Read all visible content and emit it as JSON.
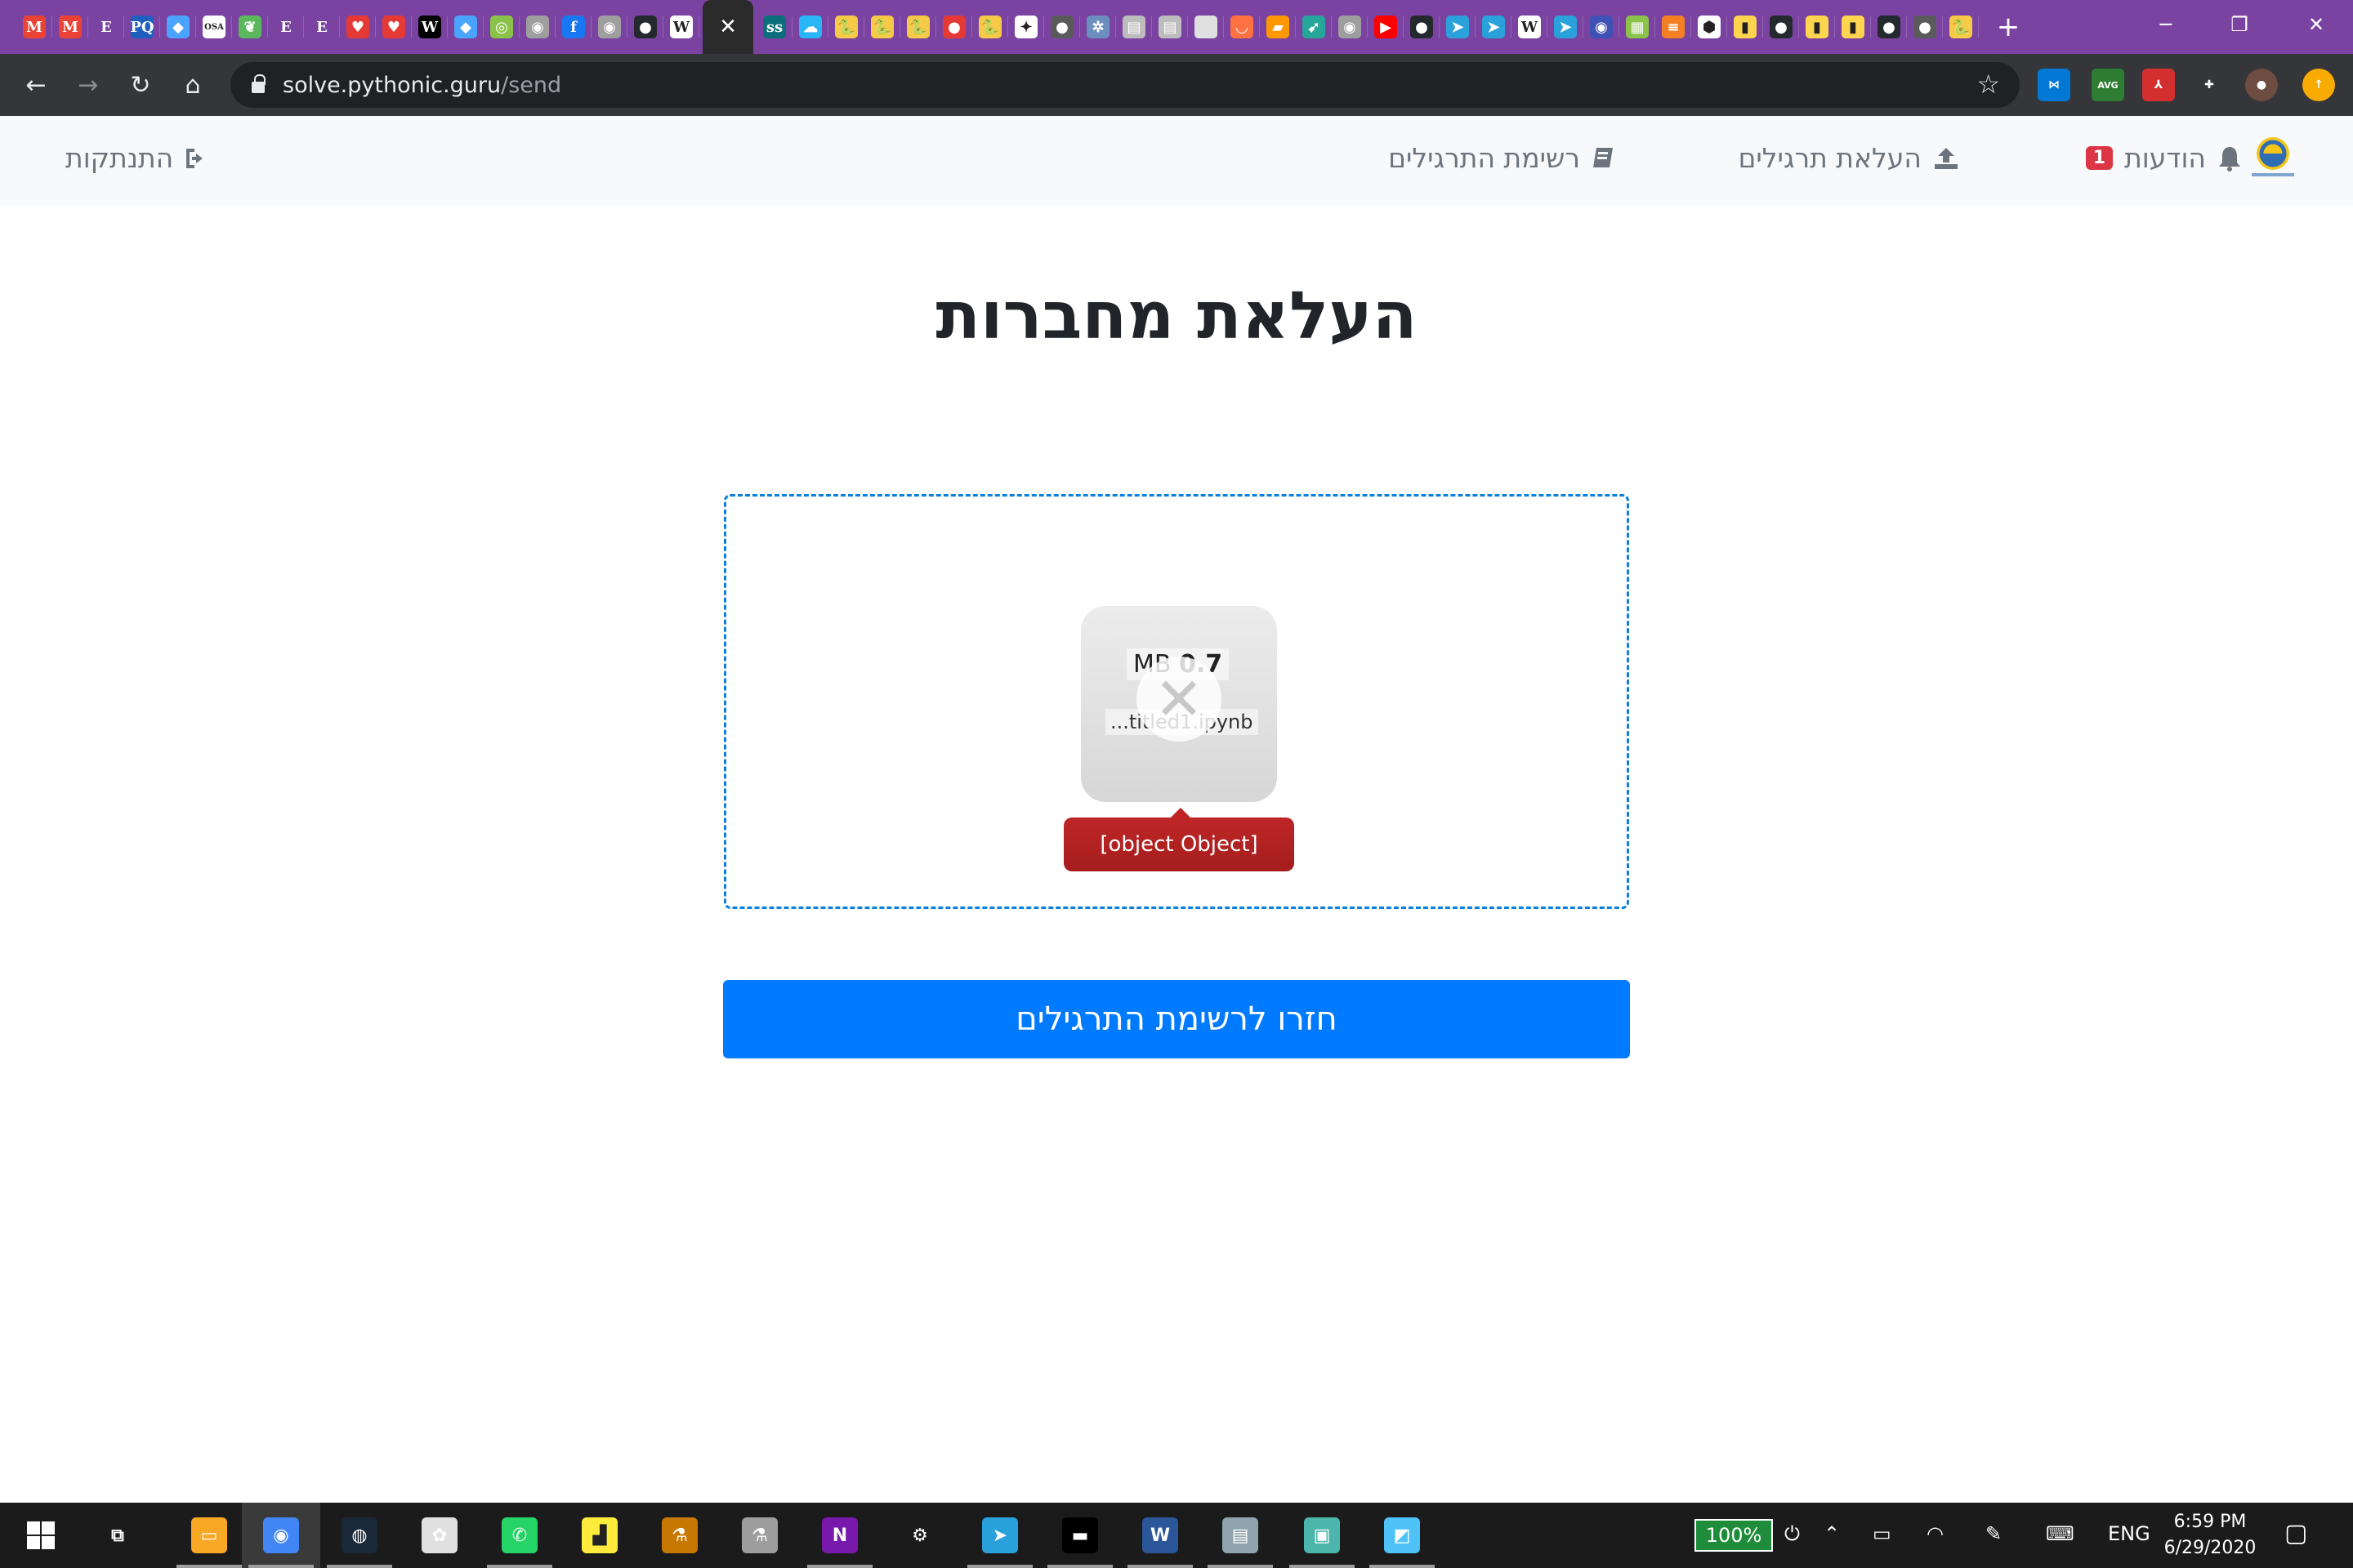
{
  "browser": {
    "tab_favicons": [
      {
        "icon": "gmail-icon",
        "color": "#ea4335",
        "glyph": "M"
      },
      {
        "icon": "gmail-icon",
        "color": "#ea4335",
        "glyph": "M"
      },
      {
        "icon": "e-icon",
        "color": "#7b43a1",
        "glyph": "E"
      },
      {
        "icon": "pq-icon",
        "color": "#1f5fbf",
        "glyph": "PQ"
      },
      {
        "icon": "shield-icon",
        "color": "#4aa3ff",
        "glyph": "◆"
      },
      {
        "icon": "osa-icon",
        "color": "#ffffff",
        "glyph": "OSA"
      },
      {
        "icon": "leaf-icon",
        "color": "#5cb85c",
        "glyph": "❦"
      },
      {
        "icon": "e-icon",
        "color": "#7b43a1",
        "glyph": "E"
      },
      {
        "icon": "e-icon",
        "color": "#7b43a1",
        "glyph": "E"
      },
      {
        "icon": "heart-icon",
        "color": "#e53935",
        "glyph": "♥"
      },
      {
        "icon": "heart-icon",
        "color": "#e53935",
        "glyph": "♥"
      },
      {
        "icon": "wikipedia-icon",
        "color": "#000000",
        "glyph": "W"
      },
      {
        "icon": "shield-icon",
        "color": "#4aa3ff",
        "glyph": "◆"
      },
      {
        "icon": "circle-icon",
        "color": "#8bc34a",
        "glyph": "◎"
      },
      {
        "icon": "globe-icon",
        "color": "#9e9e9e",
        "glyph": "◉"
      },
      {
        "icon": "facebook-icon",
        "color": "#1877f2",
        "glyph": "f"
      },
      {
        "icon": "globe-icon",
        "color": "#9e9e9e",
        "glyph": "◉"
      },
      {
        "icon": "github-icon",
        "color": "#24292e",
        "glyph": "●"
      },
      {
        "icon": "wikipedia-icon",
        "color": "#ffffff",
        "glyph": "W"
      }
    ],
    "tab_favicons_after": [
      {
        "icon": "ss-icon",
        "color": "#0b6e7a",
        "glyph": "ss"
      },
      {
        "icon": "cloud-icon",
        "color": "#29b6f6",
        "glyph": "☁"
      },
      {
        "icon": "python-icon",
        "color": "#f7c948",
        "glyph": "🐍"
      },
      {
        "icon": "python-icon",
        "color": "#f7c948",
        "glyph": "🐍"
      },
      {
        "icon": "python-icon",
        "color": "#f7c948",
        "glyph": "🐍"
      },
      {
        "icon": "red-dot-icon",
        "color": "#e53935",
        "glyph": "●"
      },
      {
        "icon": "python-icon",
        "color": "#f7c948",
        "glyph": "🐍"
      },
      {
        "icon": "butterfly-icon",
        "color": "#ffffff",
        "glyph": "✦"
      },
      {
        "icon": "dot-icon",
        "color": "#5a5a5a",
        "glyph": "●"
      },
      {
        "icon": "gear-icon",
        "color": "#6c8ebf",
        "glyph": "✲"
      },
      {
        "icon": "doc-icon",
        "color": "#bdbdbd",
        "glyph": "▤"
      },
      {
        "icon": "doc-icon",
        "color": "#bdbdbd",
        "glyph": "▤"
      },
      {
        "icon": "blank-icon",
        "color": "#e0e0e0",
        "glyph": ""
      },
      {
        "icon": "arc-icon",
        "color": "#ff7043",
        "glyph": "◡"
      },
      {
        "icon": "book-icon",
        "color": "#ff9800",
        "glyph": "▰"
      },
      {
        "icon": "arrow-icon",
        "color": "#26a69a",
        "glyph": "➹"
      },
      {
        "icon": "vinyl-icon",
        "color": "#9e9e9e",
        "glyph": "◉"
      },
      {
        "icon": "youtube-icon",
        "color": "#ff0000",
        "glyph": "▶"
      },
      {
        "icon": "github-icon",
        "color": "#24292e",
        "glyph": "●"
      },
      {
        "icon": "telegram-icon",
        "color": "#2aa1da",
        "glyph": "➤"
      },
      {
        "icon": "telegram-icon",
        "color": "#2aa1da",
        "glyph": "➤"
      },
      {
        "icon": "wikipedia-icon",
        "color": "#ffffff",
        "glyph": "W"
      },
      {
        "icon": "telegram-icon",
        "color": "#2aa1da",
        "glyph": "➤"
      },
      {
        "icon": "globe-icon",
        "color": "#3f51b5",
        "glyph": "◉"
      },
      {
        "icon": "grid-icon",
        "color": "#8bc34a",
        "glyph": "▦"
      },
      {
        "icon": "stack-icon",
        "color": "#f48024",
        "glyph": "≡"
      },
      {
        "icon": "cube-icon",
        "color": "#ffffff",
        "glyph": "⬢"
      },
      {
        "icon": "bookmark-icon",
        "color": "#ffd54f",
        "glyph": "▮"
      },
      {
        "icon": "github-icon",
        "color": "#24292e",
        "glyph": "●"
      },
      {
        "icon": "bookmark-icon",
        "color": "#ffd54f",
        "glyph": "▮"
      },
      {
        "icon": "bookmark-icon",
        "color": "#ffd54f",
        "glyph": "▮"
      },
      {
        "icon": "github-icon",
        "color": "#24292e",
        "glyph": "●"
      },
      {
        "icon": "dot-icon",
        "color": "#5a5a5a",
        "glyph": "●"
      },
      {
        "icon": "python-icon",
        "color": "#f7c948",
        "glyph": "🐍"
      }
    ],
    "active_tab_close": "✕",
    "new_tab": "+",
    "window_minimize": "─",
    "window_restore": "❐",
    "window_close": "✕",
    "back": "←",
    "forward": "→",
    "reload": "↻",
    "home": "⌂",
    "url_host": "solve.pythonic.guru",
    "url_path": "/send",
    "bookmark_star": "☆",
    "extensions": [
      {
        "icon": "vscode-icon",
        "color": "#0078d4",
        "glyph": "⋈"
      },
      {
        "icon": "avg-icon",
        "color": "#2e7d32",
        "glyph": "AVG"
      },
      {
        "icon": "pdf-icon",
        "color": "#d32f2f",
        "glyph": "⅄"
      },
      {
        "icon": "puzzle-icon",
        "color": "#35363a",
        "glyph": "✚"
      },
      {
        "icon": "avatar-icon",
        "color": "#6d4c41",
        "glyph": "●"
      },
      {
        "icon": "update-icon",
        "color": "#f9ab00",
        "glyph": "↑"
      }
    ]
  },
  "site": {
    "logo_alt": "לומדים פייתון",
    "nav": {
      "notifications_label": "הודעות",
      "notifications_count": "1",
      "upload_label": "העלאת תרגילים",
      "exercises_label": "רשימת התרגילים",
      "logout_label": "התנתקות"
    },
    "page_title": "העלאת מחברות",
    "dropzone": {
      "file_size_unit": "MB",
      "file_size_value": "0.7",
      "file_name": "...titled1.ipynb",
      "error_message": "[object Object]"
    },
    "back_button": "חזרו לרשימת התרגילים"
  },
  "taskbar": {
    "battery": "100%",
    "language": "ENG",
    "time": "6:59 PM",
    "date": "6/29/2020",
    "apps": [
      {
        "icon": "task-view-icon",
        "color": "#1b1b1b",
        "glyph": "⧉"
      },
      {
        "icon": "file-explorer-icon",
        "color": "#f9a825",
        "glyph": "▭"
      },
      {
        "icon": "chrome-icon",
        "color": "#4285f4",
        "glyph": "◉"
      },
      {
        "icon": "steam-icon",
        "color": "#1b2838",
        "glyph": "◍"
      },
      {
        "icon": "paint-icon",
        "color": "#e0e0e0",
        "glyph": "✿"
      },
      {
        "icon": "whatsapp-icon",
        "color": "#25d366",
        "glyph": "✆"
      },
      {
        "icon": "sticky-notes-icon",
        "color": "#ffeb3b",
        "glyph": "▟"
      },
      {
        "icon": "microscope-icon",
        "color": "#c77800",
        "glyph": "⚗"
      },
      {
        "icon": "microscope-icon",
        "color": "#9e9e9e",
        "glyph": "⚗"
      },
      {
        "icon": "onenote-icon",
        "color": "#7719aa",
        "glyph": "N"
      },
      {
        "icon": "settings-icon",
        "color": "#1b1b1b",
        "glyph": "⚙"
      },
      {
        "icon": "telegram-icon",
        "color": "#2aa1da",
        "glyph": "➤"
      },
      {
        "icon": "terminal-icon",
        "color": "#000000",
        "glyph": "▬"
      },
      {
        "icon": "word-icon",
        "color": "#2b579a",
        "glyph": "W"
      },
      {
        "icon": "scanner-icon",
        "color": "#90a4ae",
        "glyph": "▤"
      },
      {
        "icon": "image-viewer-icon",
        "color": "#4db6ac",
        "glyph": "▣"
      },
      {
        "icon": "notebook-icon",
        "color": "#4fc3f7",
        "glyph": "◩"
      }
    ]
  }
}
